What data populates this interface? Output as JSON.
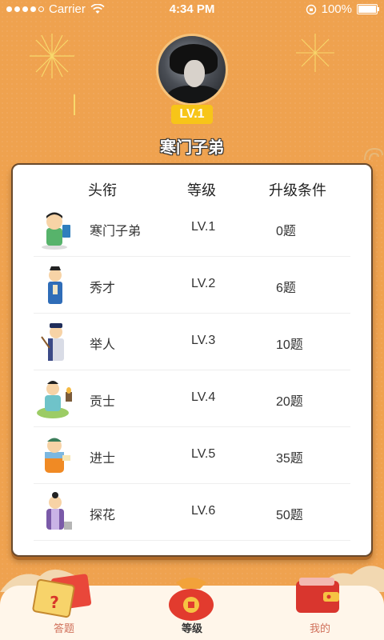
{
  "status_bar": {
    "carrier": "Carrier",
    "time": "4:34 PM",
    "battery": "100%"
  },
  "profile": {
    "level": "LV.1",
    "rank": "寒门子弟"
  },
  "table": {
    "headers": {
      "title": "头衔",
      "level": "等级",
      "condition": "升级条件"
    },
    "rows": [
      {
        "title": "寒门子弟",
        "level": "LV.1",
        "condition": "0题"
      },
      {
        "title": "秀才",
        "level": "LV.2",
        "condition": "6题"
      },
      {
        "title": "举人",
        "level": "LV.3",
        "condition": "10题"
      },
      {
        "title": "贡士",
        "level": "LV.4",
        "condition": "20题"
      },
      {
        "title": "进士",
        "level": "LV.5",
        "condition": "35题"
      },
      {
        "title": "探花",
        "level": "LV.6",
        "condition": "50题"
      }
    ]
  },
  "tabbar": {
    "tabs": [
      {
        "label": "答题",
        "icon": "quiz-card-icon"
      },
      {
        "label": "等级",
        "icon": "money-bag-icon"
      },
      {
        "label": "我的",
        "icon": "wallet-icon"
      }
    ],
    "active": "等级"
  },
  "colors": {
    "background": "#efa24f",
    "level_pill": "#f7c518",
    "card_border": "#6a4a2c"
  }
}
